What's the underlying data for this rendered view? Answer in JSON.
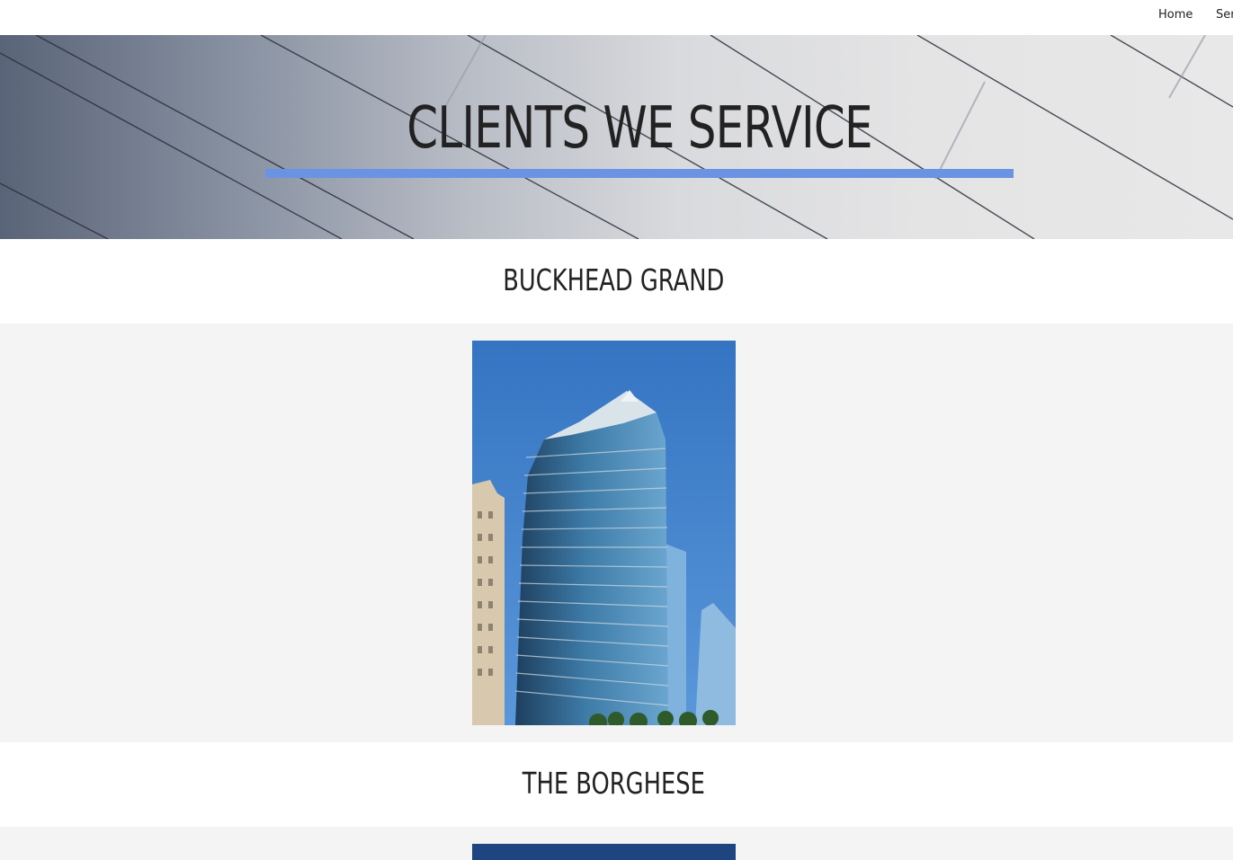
{
  "nav": {
    "home_label": "Home",
    "services_label": "Ser"
  },
  "hero": {
    "title": "CLIENTS WE SERVICE"
  },
  "clients": [
    {
      "name": "BUCKHEAD GRAND"
    },
    {
      "name": "THE BORGHESE"
    }
  ],
  "colors": {
    "accent": "#6b93e3",
    "sky": "#3e7cc8",
    "panel_bg": "#f4f4f4",
    "text": "#222222"
  }
}
